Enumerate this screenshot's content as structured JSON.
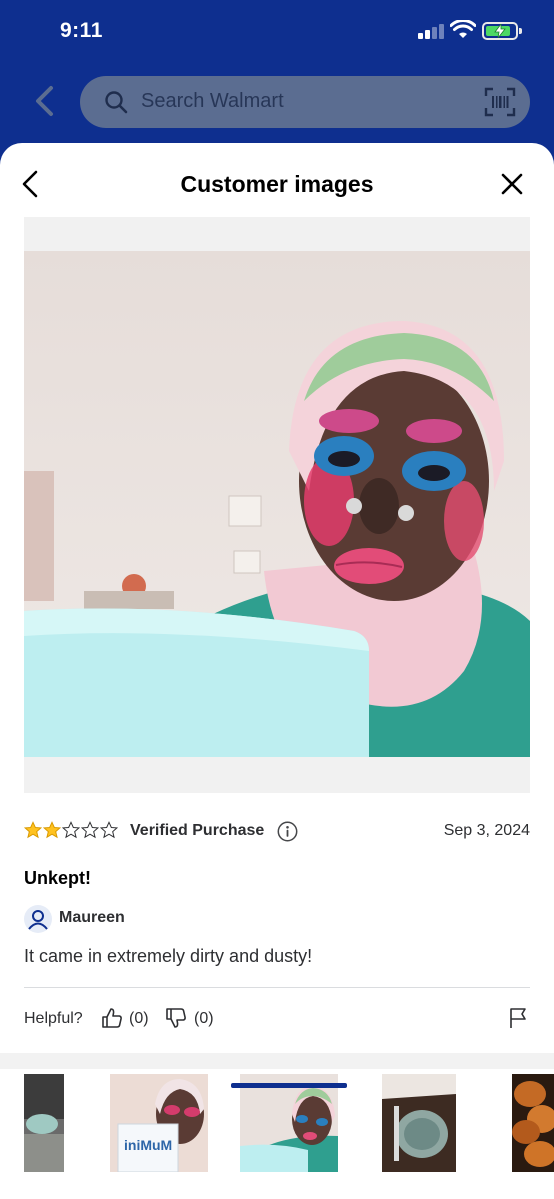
{
  "status_bar": {
    "time": "9:11"
  },
  "header": {
    "search_placeholder": "Search Walmart"
  },
  "sheet": {
    "title": "Customer images"
  },
  "review": {
    "rating": 2,
    "max_rating": 5,
    "verified_label": "Verified Purchase",
    "date": "Sep 3, 2024",
    "title": "Unkept!",
    "author": "Maureen",
    "body": "It came in extremely dirty and dusty!"
  },
  "helpful": {
    "label": "Helpful?",
    "up_count": "(0)",
    "down_count": "(0)"
  },
  "thumbnails": {
    "count": 5,
    "selected_index": 2,
    "brand_text": "iniMuM"
  },
  "colors": {
    "header_bg": "#0e2f8f",
    "star_fill": "#ffc220",
    "battery_green": "#4cd964",
    "selected_indicator": "#0e2f8f"
  },
  "icons": [
    "back-icon",
    "search-icon",
    "barcode-scan-icon",
    "close-icon",
    "info-icon",
    "user-icon",
    "thumbs-up-icon",
    "thumbs-down-icon",
    "flag-icon"
  ]
}
